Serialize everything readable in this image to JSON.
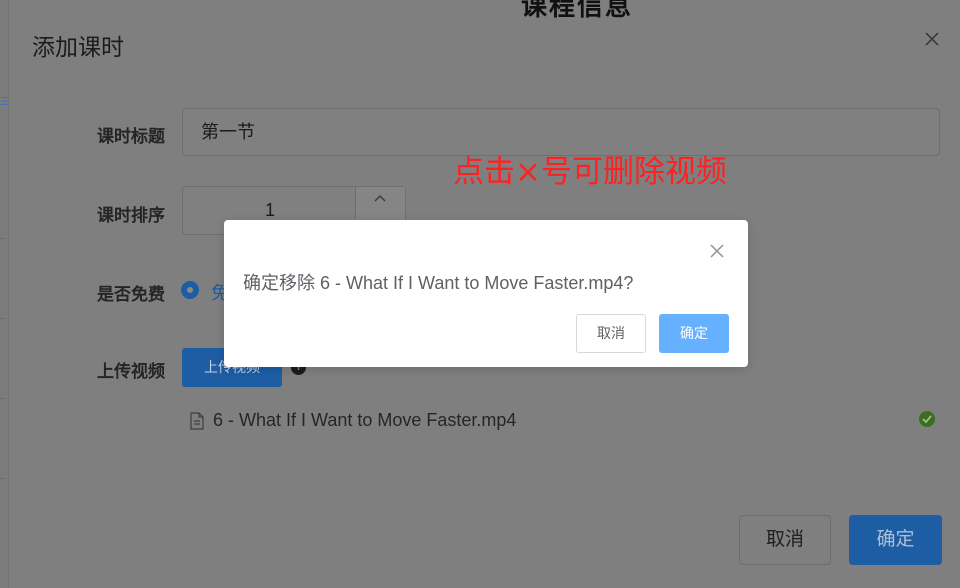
{
  "background": {
    "page_title_fragment": "课程信息"
  },
  "dialog": {
    "title": "添加课时",
    "close_icon": "close-icon",
    "form": {
      "title_label": "课时标题",
      "title_value": "第一节",
      "sort_label": "课时排序",
      "sort_value": "1",
      "free_label": "是否免费",
      "free_option": "免",
      "upload_label": "上传视频",
      "upload_button": "上传视频",
      "info_icon": "i",
      "file_name": "6 - What If I Want to Move Faster.mp4"
    },
    "annotation": "点击×号可删除视频",
    "footer": {
      "cancel": "取消",
      "ok": "确定"
    }
  },
  "confirm": {
    "message": "确定移除 6 - What If I Want to Move Faster.mp4?",
    "cancel": "取消",
    "ok": "确定"
  },
  "colors": {
    "overlay": "#7f7f7f",
    "primary": "#409eff",
    "primary_light": "#66b1ff",
    "annotation": "#ff2121",
    "success": "#67c23a"
  }
}
